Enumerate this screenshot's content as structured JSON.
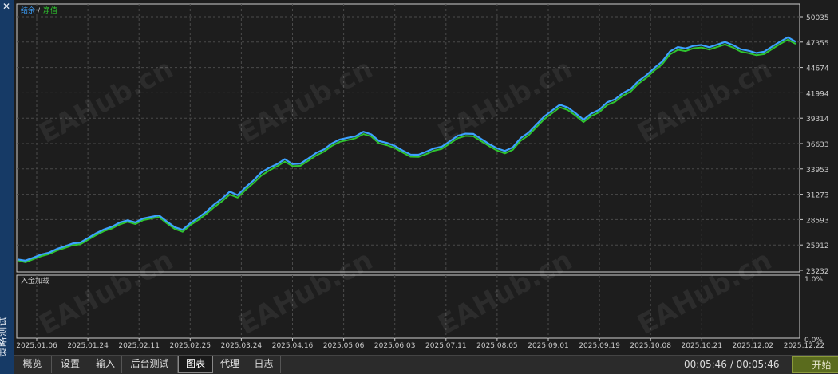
{
  "sidebar": {
    "title": "策略测试",
    "close_icon": "close-icon"
  },
  "legend": {
    "balance": "结余",
    "separator": "/",
    "equity": "净值",
    "balance_color": "#3da2ff",
    "equity_color": "#2fc42f"
  },
  "watermark": "EAHub.cn",
  "subchart": {
    "label": "入金加载",
    "top_value": "1.0%",
    "bottom_value": "0.0%"
  },
  "chart_data": {
    "type": "line",
    "title": "",
    "y_ticks": [
      "50035",
      "47355",
      "44674",
      "41994",
      "39314",
      "36633",
      "33953",
      "31273",
      "28593",
      "25912",
      "23232"
    ],
    "ylim": [
      23232,
      50035
    ],
    "x_ticks": [
      "2025.01.06",
      "2025.01.24",
      "2025.02.11",
      "2025.02.25",
      "2025.03.24",
      "2025.04.16",
      "2025.05.06",
      "2025.06.03",
      "2025.07.11",
      "2025.08.05",
      "2025.09.01",
      "2025.09.19",
      "2025.10.08",
      "2025.10.21",
      "2025.12.02",
      "2025.12.22"
    ],
    "grid": true,
    "series": [
      {
        "name": "结余",
        "color": "#3da2ff",
        "x": [
          0,
          1,
          2,
          3,
          4,
          5,
          6,
          7,
          8,
          9,
          10,
          11,
          12,
          13,
          14,
          15,
          16,
          17,
          18,
          19,
          20,
          21,
          22,
          23,
          24,
          25,
          26,
          27,
          28,
          29,
          30,
          31,
          32,
          33,
          34,
          35,
          36,
          37,
          38,
          39,
          40,
          41,
          42,
          43,
          44,
          45,
          46,
          47,
          48,
          49,
          50,
          51,
          52,
          53,
          54,
          55,
          56,
          57,
          58,
          59,
          60,
          61,
          62,
          63,
          64,
          65,
          66,
          67,
          68,
          69,
          70,
          71,
          72,
          73,
          74,
          75,
          76,
          77,
          78,
          79,
          80,
          81,
          82,
          83,
          84,
          85,
          86,
          87,
          88,
          89,
          90,
          91,
          92,
          93,
          94,
          95,
          96,
          97,
          98,
          99
        ],
        "values": [
          24390,
          24260,
          24560,
          24900,
          25100,
          25490,
          25770,
          26060,
          26170,
          26660,
          27150,
          27550,
          27840,
          28280,
          28520,
          28300,
          28720,
          28880,
          29040,
          28380,
          27790,
          27510,
          28230,
          28800,
          29420,
          30180,
          30790,
          31550,
          31180,
          32000,
          32720,
          33570,
          34060,
          34450,
          34980,
          34460,
          34510,
          35060,
          35640,
          36030,
          36650,
          37060,
          37240,
          37410,
          37880,
          37600,
          36900,
          36700,
          36390,
          35890,
          35470,
          35450,
          35770,
          36130,
          36310,
          36880,
          37460,
          37680,
          37650,
          37110,
          36580,
          36130,
          35850,
          36240,
          37210,
          37780,
          38640,
          39480,
          40120,
          40740,
          40440,
          39840,
          39150,
          39800,
          40200,
          40980,
          41300,
          41960,
          42400,
          43240,
          43850,
          44610,
          45280,
          46360,
          46820,
          46680,
          46960,
          47040,
          46810,
          47080,
          47360,
          47040,
          46600,
          46440,
          46200,
          46340,
          46880,
          47390,
          47860,
          47380
        ]
      },
      {
        "name": "净值",
        "color": "#2fc42f",
        "x": [
          0,
          1,
          2,
          3,
          4,
          5,
          6,
          7,
          8,
          9,
          10,
          11,
          12,
          13,
          14,
          15,
          16,
          17,
          18,
          19,
          20,
          21,
          22,
          23,
          24,
          25,
          26,
          27,
          28,
          29,
          30,
          31,
          32,
          33,
          34,
          35,
          36,
          37,
          38,
          39,
          40,
          41,
          42,
          43,
          44,
          45,
          46,
          47,
          48,
          49,
          50,
          51,
          52,
          53,
          54,
          55,
          56,
          57,
          58,
          59,
          60,
          61,
          62,
          63,
          64,
          65,
          66,
          67,
          68,
          69,
          70,
          71,
          72,
          73,
          74,
          75,
          76,
          77,
          78,
          79,
          80,
          81,
          82,
          83,
          84,
          85,
          86,
          87,
          88,
          89,
          90,
          91,
          92,
          93,
          94,
          95,
          96,
          97,
          98,
          99
        ],
        "values": [
          24300,
          24080,
          24400,
          24720,
          24950,
          25320,
          25600,
          25880,
          26000,
          26480,
          26960,
          27380,
          27660,
          28080,
          28360,
          28120,
          28540,
          28700,
          28860,
          28200,
          27600,
          27300,
          28020,
          28560,
          29180,
          29900,
          30520,
          31240,
          30920,
          31720,
          32440,
          33240,
          33780,
          34220,
          34720,
          34240,
          34280,
          34820,
          35380,
          35780,
          36400,
          36820,
          37000,
          37200,
          37640,
          37380,
          36660,
          36460,
          36160,
          35680,
          35240,
          35220,
          35520,
          35880,
          36080,
          36640,
          37200,
          37440,
          37400,
          36880,
          36360,
          35900,
          35600,
          35980,
          36940,
          37500,
          38360,
          39200,
          39840,
          40460,
          40180,
          39580,
          38900,
          39540,
          39940,
          40700,
          41040,
          41680,
          42120,
          42960,
          43580,
          44340,
          45000,
          46060,
          46540,
          46400,
          46700,
          46780,
          46560,
          46820,
          47100,
          46780,
          46340,
          46180,
          45960,
          46080,
          46620,
          47140,
          47600,
          47160
        ]
      }
    ]
  },
  "tabs": [
    {
      "label": "概览",
      "active": false
    },
    {
      "label": "设置",
      "active": false
    },
    {
      "label": "输入",
      "active": false
    },
    {
      "label": "后台测试",
      "active": false
    },
    {
      "label": "图表",
      "active": true
    },
    {
      "label": "代理",
      "active": false
    },
    {
      "label": "日志",
      "active": false
    }
  ],
  "timer": "00:05:46 / 00:05:46",
  "start_button": "开始"
}
